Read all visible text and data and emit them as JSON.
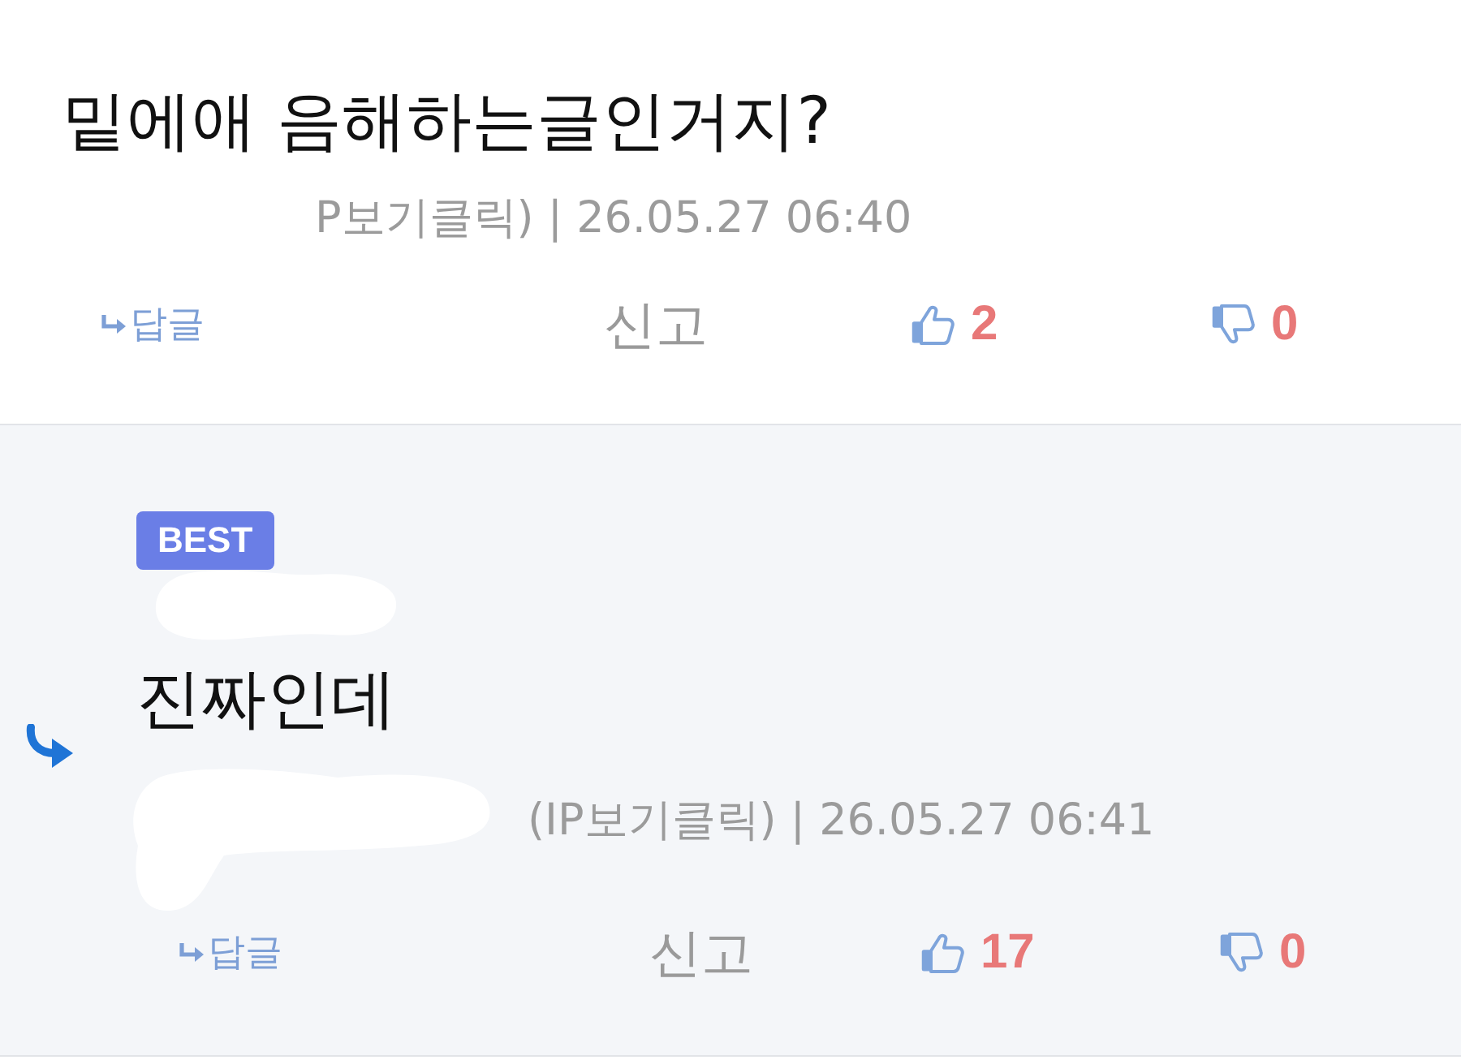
{
  "comments": [
    {
      "text": "밑에애 음해하는글인거지?",
      "is_reply": false,
      "redacted": false,
      "meta": "P보기클릭) | 26.05.27 06:40",
      "reply": "답글",
      "report": "신고",
      "likes": "2",
      "dislikes": "0"
    },
    {
      "badge": "BEST",
      "text": "진짜인데",
      "is_reply": true,
      "redacted": true,
      "meta": "(IP보기클릭) | 26.05.27 06:41",
      "reply": "답글",
      "report": "신고",
      "likes": "17",
      "dislikes": "0"
    }
  ]
}
